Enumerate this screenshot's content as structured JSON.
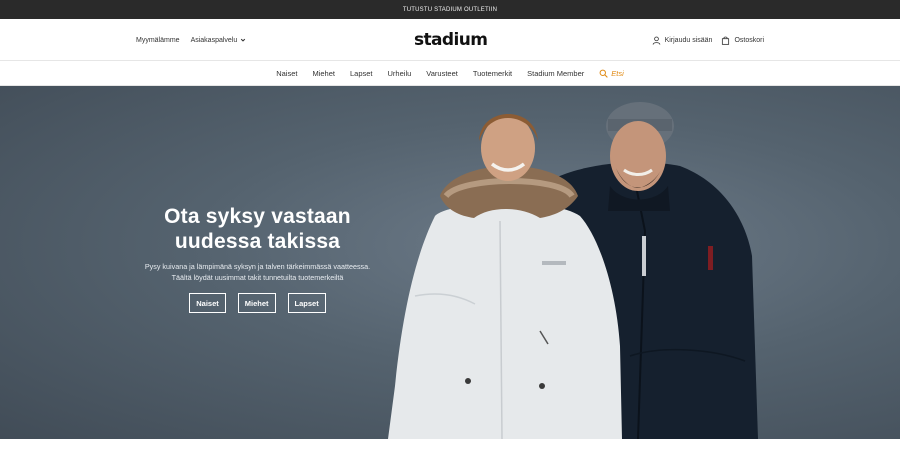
{
  "promo": {
    "text": "TUTUSTU STADIUM OUTLETIIN"
  },
  "header": {
    "left_links": [
      {
        "label": "Myymälämme",
        "icon": ""
      },
      {
        "label": "Asiakaspalvelu",
        "icon": "chevron-down-icon"
      }
    ],
    "logo": "stadium",
    "right_links": [
      {
        "label": "Kirjaudu sisään",
        "icon": "user-icon"
      },
      {
        "label": "Ostoskori",
        "icon": "shopping-bag-icon"
      }
    ]
  },
  "nav": {
    "items": [
      "Naiset",
      "Miehet",
      "Lapset",
      "Urheilu",
      "Varusteet",
      "Tuotemerkit",
      "Stadium Member"
    ],
    "search_label": "Etsi",
    "search_icon": "search-icon",
    "search_color": "#e08a14"
  },
  "hero": {
    "title": "Ota syksy vastaan uudessa takissa",
    "subtitle": "Pysy kuivana ja lämpimänä syksyn ja talven tärkeimmässä vaatteessa. Täältä löydät uusimmat takit tunnetuilta tuotemerkeiltä",
    "buttons": [
      "Naiset",
      "Miehet",
      "Lapset"
    ]
  }
}
